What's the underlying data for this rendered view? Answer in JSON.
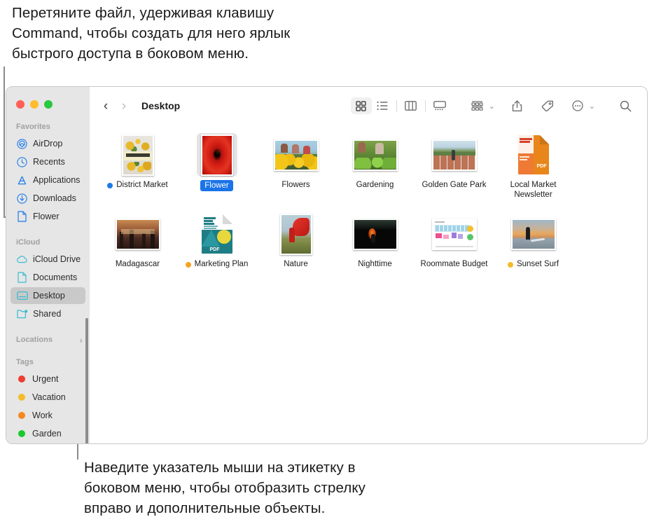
{
  "annotations": {
    "top": "Перетяните файл, удерживая клавишу\nCommand, чтобы создать для него ярлык\nбыстрого доступа в боковом меню.",
    "bottom": "Наведите указатель мыши на этикетку в\nбоковом меню, чтобы отобразить стрелку\nвправо и дополнительные объекты."
  },
  "window": {
    "traffic_lights": [
      {
        "name": "close",
        "color": "#ff5f57"
      },
      {
        "name": "minimize",
        "color": "#febc2e"
      },
      {
        "name": "maximize",
        "color": "#28c840"
      }
    ]
  },
  "toolbar": {
    "back_label": "‹",
    "forward_label": "›",
    "breadcrumb": "Desktop",
    "view_icon_label": "icon-view",
    "view_list_label": "list-view",
    "view_column_label": "column-view",
    "view_gallery_label": "gallery-view",
    "group_label": "group-by",
    "share_label": "share",
    "tag_label": "tag",
    "more_label": "more-actions",
    "search_label": "search",
    "chevron": "⌄"
  },
  "sidebar": {
    "sections": [
      {
        "header": "Favorites",
        "has_chevron": false,
        "items": [
          {
            "label": "AirDrop",
            "icon": "airdrop-icon",
            "color": "#1e7ae8",
            "selected": false
          },
          {
            "label": "Recents",
            "icon": "clock-icon",
            "color": "#1e7ae8",
            "selected": false
          },
          {
            "label": "Applications",
            "icon": "applications-icon",
            "color": "#1e7ae8",
            "selected": false
          },
          {
            "label": "Downloads",
            "icon": "downloads-icon",
            "color": "#1e7ae8",
            "selected": false
          },
          {
            "label": "Flower",
            "icon": "document-icon",
            "color": "#1e7ae8",
            "selected": false
          }
        ]
      },
      {
        "header": "iCloud",
        "has_chevron": false,
        "items": [
          {
            "label": "iCloud Drive",
            "icon": "cloud-icon",
            "color": "#39bcd0",
            "selected": false
          },
          {
            "label": "Documents",
            "icon": "document-icon",
            "color": "#39bcd0",
            "selected": false
          },
          {
            "label": "Desktop",
            "icon": "desktop-icon",
            "color": "#39bcd0",
            "selected": true
          },
          {
            "label": "Shared",
            "icon": "shared-folder-icon",
            "color": "#39bcd0",
            "selected": false
          }
        ]
      },
      {
        "header": "Locations",
        "has_chevron": true,
        "items": []
      },
      {
        "header": "Tags",
        "has_chevron": false,
        "items": [
          {
            "label": "Urgent",
            "icon": "tag-dot",
            "color": "#f03b30",
            "selected": false
          },
          {
            "label": "Vacation",
            "icon": "tag-dot",
            "color": "#f5bc29",
            "selected": false
          },
          {
            "label": "Work",
            "icon": "tag-dot",
            "color": "#f7881f",
            "selected": false
          },
          {
            "label": "Garden",
            "icon": "tag-dot",
            "color": "#19ca2c",
            "selected": false
          }
        ]
      }
    ]
  },
  "files": [
    {
      "label": "District Market",
      "thumb": "district-market-poster",
      "shape": "portrait",
      "dot": "#1e7ae8",
      "selected": false
    },
    {
      "label": "Flower",
      "thumb": "red-flower-photo",
      "shape": "portrait",
      "dot": null,
      "selected": true
    },
    {
      "label": "Flowers",
      "thumb": "sunflowers-people-photo",
      "shape": "landscape",
      "dot": null,
      "selected": false
    },
    {
      "label": "Gardening",
      "thumb": "gardening-photo",
      "shape": "landscape",
      "dot": null,
      "selected": false
    },
    {
      "label": "Golden Gate Park",
      "thumb": "running-track-photo",
      "shape": "landscape",
      "dot": null,
      "selected": false
    },
    {
      "label": "Local Market Newsletter",
      "thumb": "pdf-newsletter",
      "shape": "doc-pdf-orange",
      "dot": null,
      "selected": false
    },
    {
      "label": "Madagascar",
      "thumb": "madagascar-photo",
      "shape": "landscape",
      "dot": null,
      "selected": false
    },
    {
      "label": "Marketing Plan",
      "thumb": "pdf-marketing-plan",
      "shape": "doc-pdf-teal",
      "dot": "#f7a31f",
      "selected": false
    },
    {
      "label": "Nature",
      "thumb": "red-fabric-field-photo",
      "shape": "portrait",
      "dot": null,
      "selected": false
    },
    {
      "label": "Nighttime",
      "thumb": "nighttime-photo",
      "shape": "landscape",
      "dot": null,
      "selected": false
    },
    {
      "label": "Roommate Budget",
      "thumb": "spreadsheet-doc",
      "shape": "landscape-doc",
      "dot": null,
      "selected": false
    },
    {
      "label": "Sunset Surf",
      "thumb": "sunset-surf-photo",
      "shape": "landscape",
      "dot": "#f5bc29",
      "selected": false
    }
  ]
}
